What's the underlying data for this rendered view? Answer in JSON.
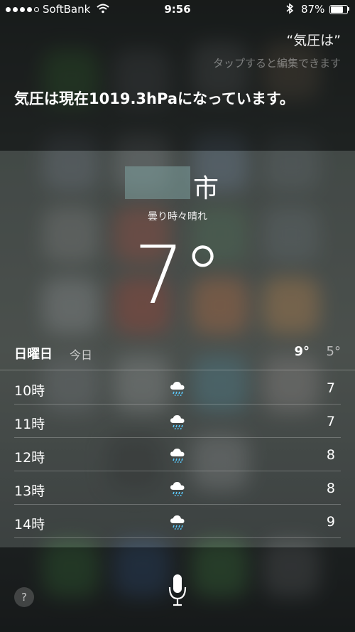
{
  "status_bar": {
    "carrier": "SoftBank",
    "time": "9:56",
    "battery_percent": "87%",
    "battery_level": 0.87,
    "signal_bars_filled": 4,
    "signal_bars_total": 5
  },
  "siri": {
    "query": "“気圧は”",
    "edit_hint": "タップすると編集できます",
    "answer": "気圧は現在1019.3hPaになっています。"
  },
  "weather": {
    "city_suffix": "市",
    "condition": "曇り時々晴れ",
    "current_temp": "7°",
    "day": {
      "name": "日曜日",
      "sub": "今日",
      "high": "9°",
      "low": "5°"
    },
    "hourly": [
      {
        "hour": "10時",
        "temp": "7",
        "icon": "cloud-rain-icon"
      },
      {
        "hour": "11時",
        "temp": "7",
        "icon": "cloud-rain-icon"
      },
      {
        "hour": "12時",
        "temp": "8",
        "icon": "cloud-rain-icon"
      },
      {
        "hour": "13時",
        "temp": "8",
        "icon": "cloud-rain-icon"
      },
      {
        "hour": "14時",
        "temp": "9",
        "icon": "cloud-rain-icon"
      }
    ]
  },
  "bottom": {
    "help_label": "?"
  }
}
